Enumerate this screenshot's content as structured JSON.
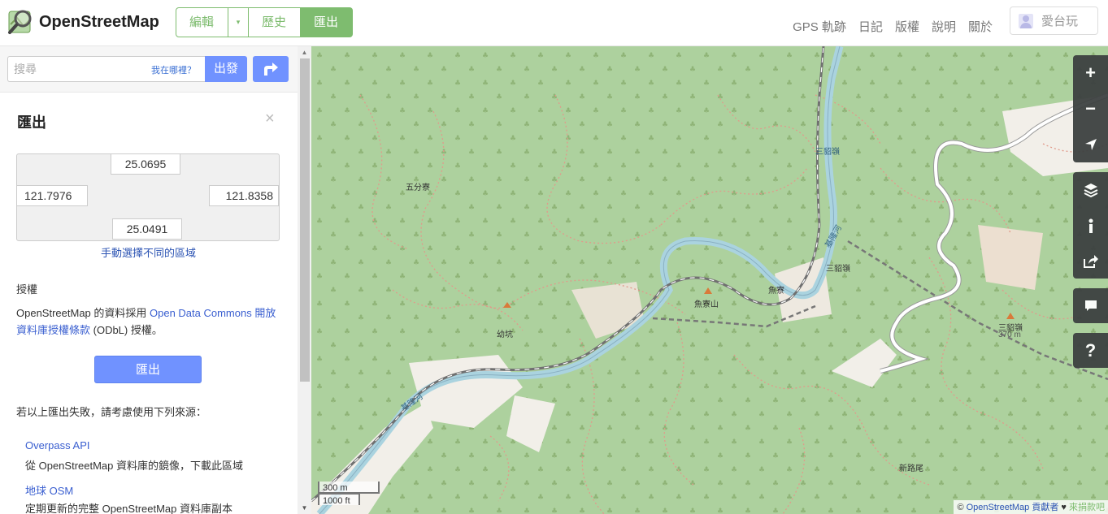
{
  "header": {
    "brand": "OpenStreetMap",
    "edit_tabs": {
      "edit": "編輯",
      "dropdown": "▾",
      "history": "歷史",
      "export": "匯出"
    },
    "nav": [
      "GPS 軌跡",
      "日記",
      "版權",
      "說明",
      "關於"
    ],
    "user": "愛台玩"
  },
  "search": {
    "placeholder": "搜尋",
    "where_am_i": "我在哪裡？",
    "go": "出發"
  },
  "export_panel": {
    "title": "匯出",
    "close": "×",
    "bbox": {
      "max_lat": "25.0695",
      "min_lon": "121.7976",
      "max_lon": "121.8358",
      "min_lat": "25.0491"
    },
    "manual_select": "手動選擇不同的區域",
    "license_heading": "授權",
    "license_prefix": "OpenStreetMap 的資料採用 ",
    "license_link": "Open Data Commons 開放資料庫授權條款",
    "license_suffix": " (ODbL) 授權。",
    "export_button": "匯出",
    "fail_text": "若以上匯出失敗，請考慮使用下列來源：",
    "sources": [
      {
        "title": "Overpass API",
        "desc": "從 OpenStreetMap 資料庫的鏡像，下載此區域"
      },
      {
        "title": "地球 OSM",
        "desc": "定期更新的完整 OpenStreetMap 資料庫副本"
      }
    ]
  },
  "map": {
    "labels": [
      "五分寮",
      "三貂嶺",
      "三貂嶺",
      "魚寮",
      "魚寮山",
      "幼坑",
      "三貂嶺",
      "370 m",
      "新路尾",
      "基隆河",
      "基隆河"
    ],
    "controls": {
      "zoom_in": "+",
      "zoom_out": "−",
      "help": "?"
    },
    "scale_metric": "300 m",
    "scale_imperial": "1000 ft",
    "attribution_prefix": "© ",
    "attribution_link": "OpenStreetMap 貢獻者",
    "attribution_heart": " ♥ ",
    "attribution_donate": "來捐款吧"
  },
  "colors": {
    "accent_green": "#7ebc6f",
    "button_blue": "#7092ff",
    "link_blue": "#3a5fd0",
    "map_green": "#b6d59c",
    "river": "#aad3df"
  }
}
